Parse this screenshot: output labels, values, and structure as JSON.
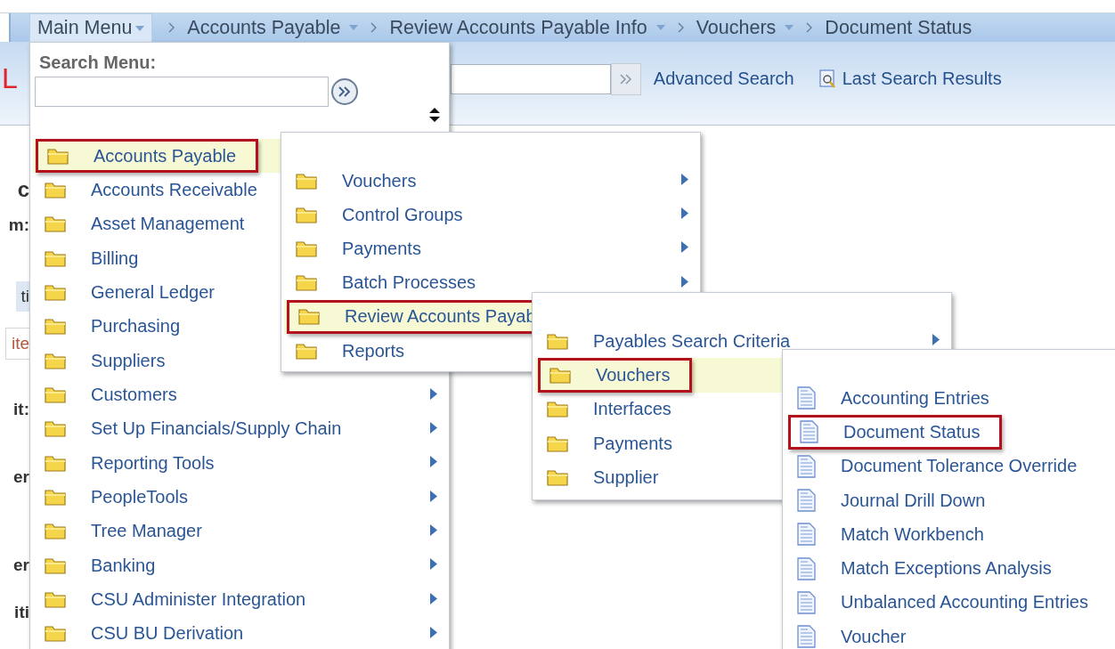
{
  "breadcrumb": {
    "main_menu": "Main Menu",
    "items": [
      {
        "label": "Accounts Payable",
        "dropdown": true
      },
      {
        "label": "Review Accounts Payable Info",
        "dropdown": true
      },
      {
        "label": "Vouchers",
        "dropdown": true
      },
      {
        "label": "Document Status",
        "dropdown": false
      }
    ]
  },
  "toolbar": {
    "brand": "L",
    "advanced_search": "Advanced Search",
    "last_search_results": "Last Search Results"
  },
  "page_fragments": [
    {
      "text": "c",
      "kind": "heading"
    },
    {
      "text": "m:",
      "kind": "label"
    },
    {
      "text": "ti",
      "kind": "tab"
    },
    {
      "text": "ite",
      "kind": "box"
    },
    {
      "text": "it:",
      "kind": "label"
    },
    {
      "text": "er",
      "kind": "label"
    },
    {
      "text": "er",
      "kind": "label"
    },
    {
      "text": "iti",
      "kind": "label"
    }
  ],
  "main_menu": {
    "search_label": "Search Menu:",
    "items": [
      {
        "label": "Accounts Payable",
        "kind": "folder",
        "selected": true,
        "highlighted": true
      },
      {
        "label": "Accounts Receivable",
        "kind": "folder",
        "selected": false,
        "highlighted": false
      },
      {
        "label": "Asset Management",
        "kind": "folder",
        "selected": false,
        "highlighted": false
      },
      {
        "label": "Billing",
        "kind": "folder",
        "selected": false,
        "highlighted": false
      },
      {
        "label": "General Ledger",
        "kind": "folder",
        "selected": false,
        "highlighted": false
      },
      {
        "label": "Purchasing",
        "kind": "folder",
        "selected": false,
        "highlighted": false
      },
      {
        "label": "Suppliers",
        "kind": "folder",
        "selected": false,
        "highlighted": false
      },
      {
        "label": "Customers",
        "kind": "folder",
        "selected": false,
        "highlighted": false,
        "submenu": true
      },
      {
        "label": "Set Up Financials/Supply Chain",
        "kind": "folder",
        "selected": false,
        "highlighted": false,
        "submenu": true
      },
      {
        "label": "Reporting Tools",
        "kind": "folder",
        "selected": false,
        "highlighted": false,
        "submenu": true
      },
      {
        "label": "PeopleTools",
        "kind": "folder",
        "selected": false,
        "highlighted": false,
        "submenu": true
      },
      {
        "label": "Tree Manager",
        "kind": "folder",
        "selected": false,
        "highlighted": false,
        "submenu": true
      },
      {
        "label": "Banking",
        "kind": "folder",
        "selected": false,
        "highlighted": false,
        "submenu": true
      },
      {
        "label": "CSU Administer Integration",
        "kind": "folder",
        "selected": false,
        "highlighted": false,
        "submenu": true
      },
      {
        "label": "CSU BU Derivation",
        "kind": "folder",
        "selected": false,
        "highlighted": false,
        "submenu": true
      }
    ]
  },
  "flyouts": [
    {
      "items": [
        {
          "label": "Vouchers",
          "kind": "folder",
          "selected": false,
          "highlighted": false,
          "submenu": true
        },
        {
          "label": "Control Groups",
          "kind": "folder",
          "selected": false,
          "highlighted": false,
          "submenu": true
        },
        {
          "label": "Payments",
          "kind": "folder",
          "selected": false,
          "highlighted": false,
          "submenu": true
        },
        {
          "label": "Batch Processes",
          "kind": "folder",
          "selected": false,
          "highlighted": false,
          "submenu": true
        },
        {
          "label": "Review Accounts Payab",
          "kind": "folder",
          "selected": true,
          "highlighted": true
        },
        {
          "label": "Reports",
          "kind": "folder",
          "selected": false,
          "highlighted": false
        }
      ]
    },
    {
      "items": [
        {
          "label": "Payables Search Criteria",
          "kind": "folder",
          "selected": false,
          "highlighted": false,
          "submenu": true
        },
        {
          "label": "Vouchers",
          "kind": "folder",
          "selected": true,
          "highlighted": true
        },
        {
          "label": "Interfaces",
          "kind": "folder",
          "selected": false,
          "highlighted": false
        },
        {
          "label": "Payments",
          "kind": "folder",
          "selected": false,
          "highlighted": false
        },
        {
          "label": "Supplier",
          "kind": "folder",
          "selected": false,
          "highlighted": false
        }
      ]
    },
    {
      "items": [
        {
          "label": "Accounting Entries",
          "kind": "page",
          "selected": false,
          "highlighted": false
        },
        {
          "label": "Document Status",
          "kind": "page",
          "selected": true,
          "highlighted": false
        },
        {
          "label": "Document Tolerance Override",
          "kind": "page",
          "selected": false,
          "highlighted": false
        },
        {
          "label": "Journal Drill Down",
          "kind": "page",
          "selected": false,
          "highlighted": false
        },
        {
          "label": "Match Workbench",
          "kind": "page",
          "selected": false,
          "highlighted": false
        },
        {
          "label": "Match Exceptions Analysis",
          "kind": "page",
          "selected": false,
          "highlighted": false
        },
        {
          "label": "Unbalanced Accounting Entries",
          "kind": "page",
          "selected": false,
          "highlighted": false
        },
        {
          "label": "Voucher",
          "kind": "page",
          "selected": false,
          "highlighted": false
        }
      ]
    }
  ]
}
